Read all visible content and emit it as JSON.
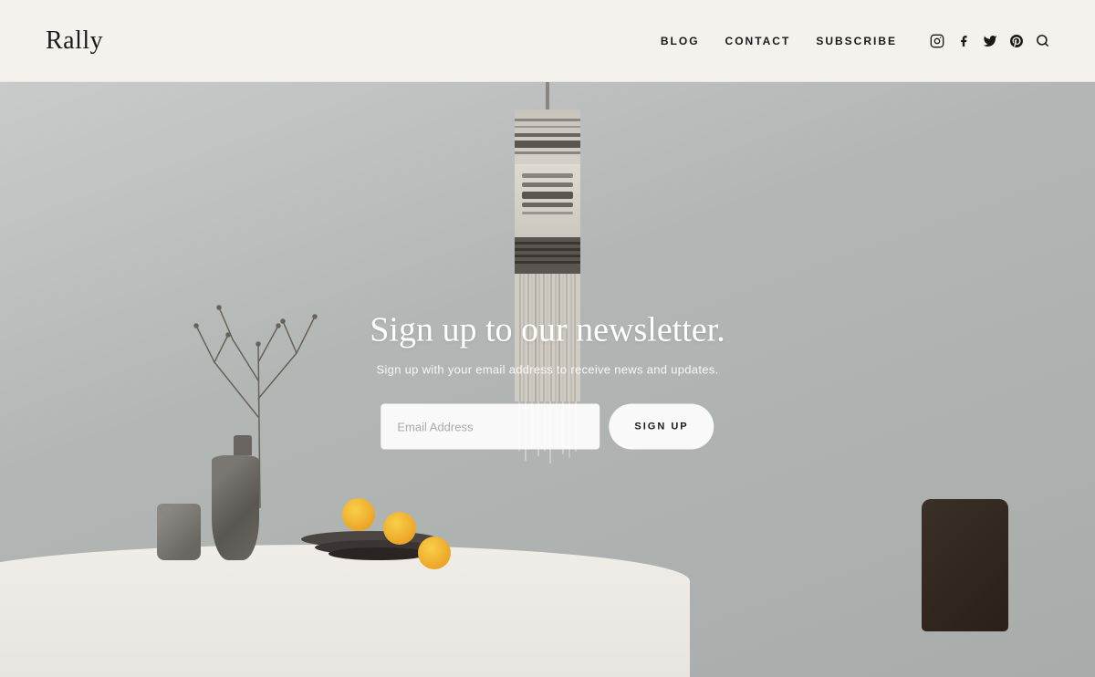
{
  "header": {
    "logo": "Rally",
    "nav": {
      "items": [
        {
          "label": "BLOG",
          "id": "blog"
        },
        {
          "label": "CONTACT",
          "id": "contact"
        },
        {
          "label": "SUBSCRIBE",
          "id": "subscribe"
        }
      ]
    },
    "social_icons": [
      {
        "name": "instagram-icon",
        "glyph": "𝄜"
      },
      {
        "name": "facebook-icon",
        "glyph": "f"
      },
      {
        "name": "twitter-icon",
        "glyph": "𝕏"
      },
      {
        "name": "pinterest-icon",
        "glyph": "𝒫"
      },
      {
        "name": "search-icon",
        "glyph": "🔍"
      }
    ]
  },
  "hero": {
    "newsletter": {
      "headline": "Sign up to our newsletter.",
      "subtext": "Sign up with your email address to receive news and updates.",
      "email_placeholder": "Email Address",
      "button_label": "SIGN UP"
    }
  }
}
